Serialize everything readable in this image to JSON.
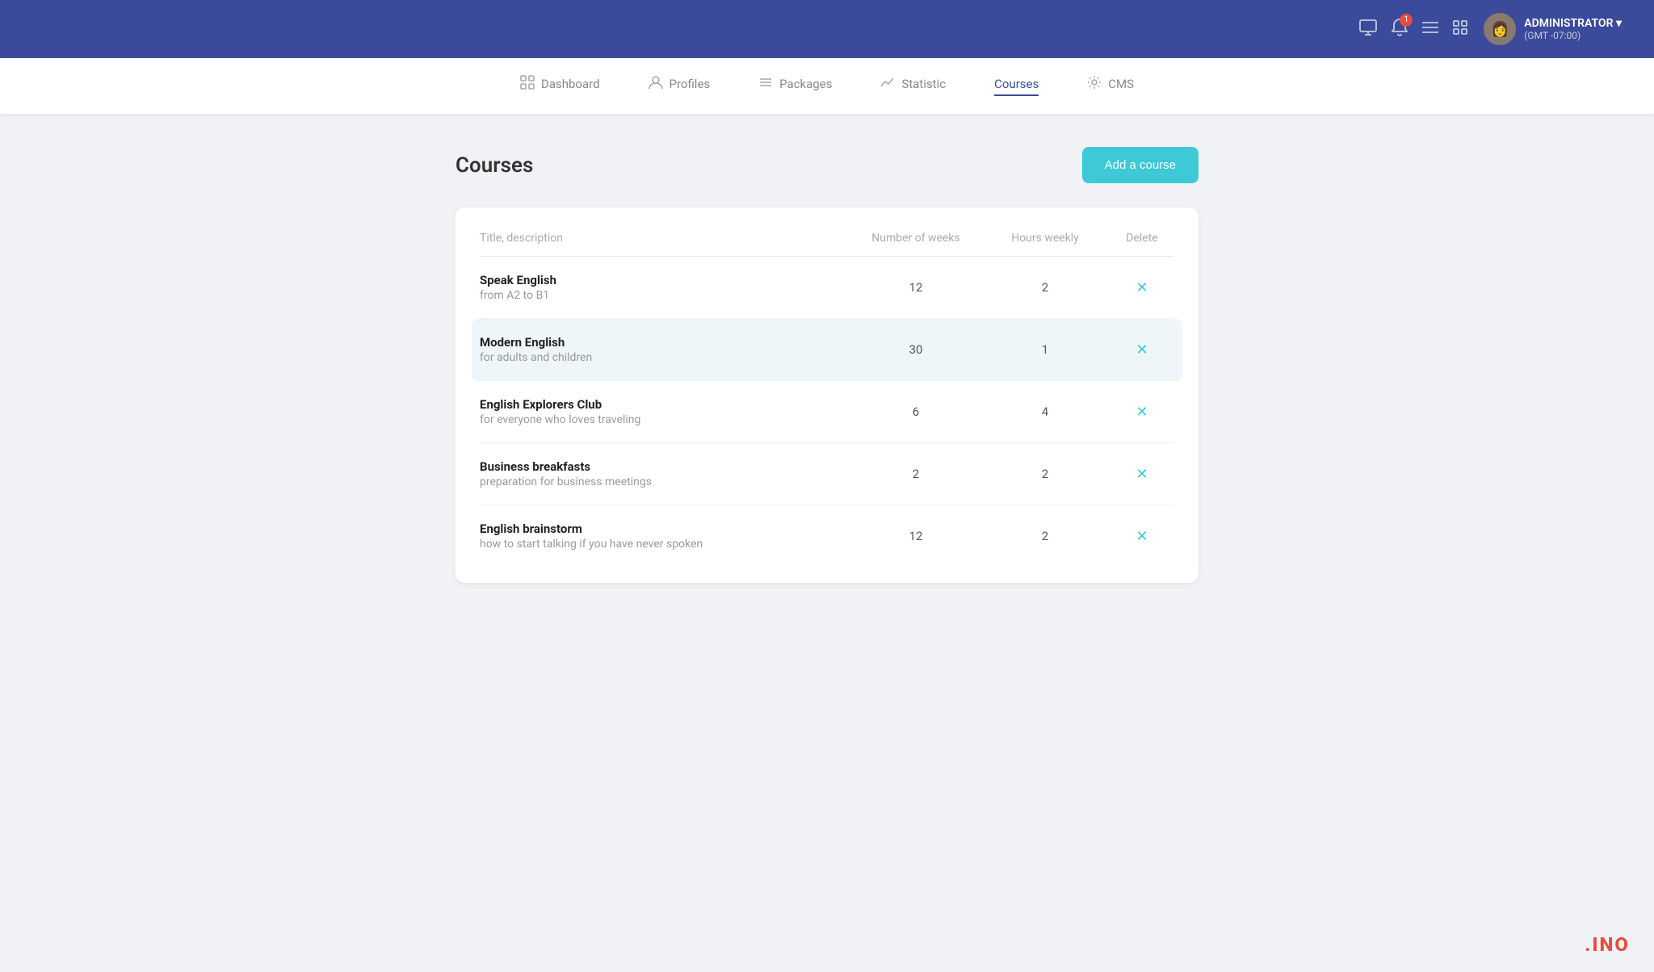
{
  "topbar": {
    "username": "ADMINISTRATOR",
    "username_arrow": "▾",
    "timezone": "(GMT -07:00)",
    "notification_count": "1"
  },
  "navbar": {
    "items": [
      {
        "id": "dashboard",
        "label": "Dashboard",
        "icon": "⊞",
        "active": false
      },
      {
        "id": "profiles",
        "label": "Profiles",
        "icon": "◎",
        "active": false
      },
      {
        "id": "packages",
        "label": "Packages",
        "icon": "≡",
        "active": false
      },
      {
        "id": "statistic",
        "label": "Statistic",
        "icon": "📈",
        "active": false
      },
      {
        "id": "courses",
        "label": "Courses",
        "icon": "",
        "active": true
      },
      {
        "id": "cms",
        "label": "CMS",
        "icon": "⚙",
        "active": false
      }
    ]
  },
  "page": {
    "title": "Courses",
    "add_button": "Add a course"
  },
  "table": {
    "headers": {
      "title_desc": "Title, description",
      "num_weeks": "Number of weeks",
      "hours_weekly": "Hours weekly",
      "delete": "Delete"
    },
    "rows": [
      {
        "id": "row-1",
        "title": "Speak English",
        "description": "from A2 to B1",
        "weeks": "12",
        "hours": "2",
        "highlighted": false
      },
      {
        "id": "row-2",
        "title": "Modern English",
        "description": "for adults and children",
        "weeks": "30",
        "hours": "1",
        "highlighted": true
      },
      {
        "id": "row-3",
        "title": "English Explorers Club",
        "description": "for everyone who loves traveling",
        "weeks": "6",
        "hours": "4",
        "highlighted": false
      },
      {
        "id": "row-4",
        "title": "Business breakfasts",
        "description": "preparation for business meetings",
        "weeks": "2",
        "hours": "2",
        "highlighted": false
      },
      {
        "id": "row-5",
        "title": "English brainstorm",
        "description": "how to start talking if you have never spoken",
        "weeks": "12",
        "hours": "2",
        "highlighted": false
      }
    ]
  },
  "watermark": ".INO"
}
